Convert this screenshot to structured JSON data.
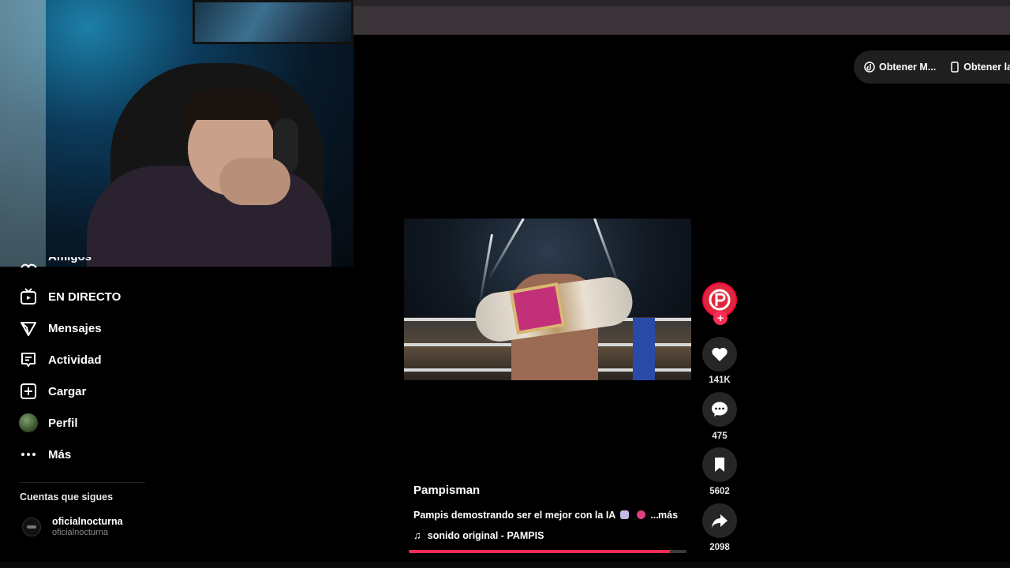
{
  "sidebar": {
    "items": [
      {
        "label": "Amigos",
        "icon": "friends-icon"
      },
      {
        "label": "EN DIRECTO",
        "icon": "live-tv-icon"
      },
      {
        "label": "Mensajes",
        "icon": "send-icon"
      },
      {
        "label": "Actividad",
        "icon": "activity-icon"
      },
      {
        "label": "Cargar",
        "icon": "upload-plus-icon"
      },
      {
        "label": "Perfil",
        "icon": "profile-avatar"
      },
      {
        "label": "Más",
        "icon": "more-dots-icon"
      }
    ],
    "following_title": "Cuentas que sigues",
    "following": [
      {
        "name": "oficialnocturna",
        "handle": "oficialnocturna"
      }
    ]
  },
  "header": {
    "pills": [
      {
        "label": "Obtener M...",
        "icon": "tiktok-icon"
      },
      {
        "label": "Obtener la",
        "icon": "phone-icon"
      }
    ]
  },
  "video": {
    "author": "Pampisman",
    "description": "Pampis demostrando ser el mejor con la IA",
    "ellipsis": "...",
    "more": "más",
    "sound": "sonido original - PAMPIS",
    "progress": 0.94
  },
  "actions": {
    "likes": "141K",
    "comments": "475",
    "saves": "5602",
    "shares": "2098"
  },
  "colors": {
    "accent": "#fe2c55",
    "background": "#000000",
    "rail_button": "#262626"
  }
}
